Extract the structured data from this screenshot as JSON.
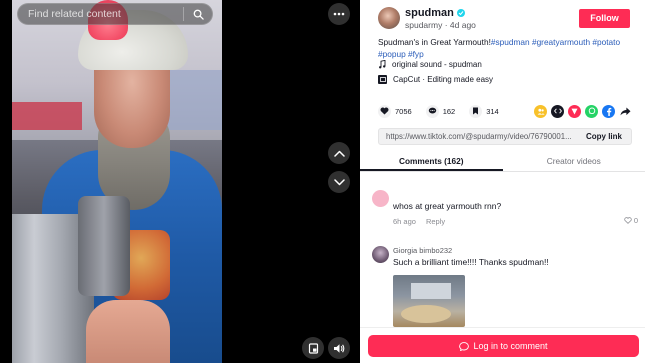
{
  "video": {
    "search": {
      "placeholder": "Find related content"
    }
  },
  "author": {
    "name": "spudman",
    "handle": "spudarmy",
    "posted": "4d ago",
    "follow_label": "Follow"
  },
  "caption": {
    "text": "Spudman's in Great Yarmouth!",
    "tags": [
      "#spudman",
      "#greatyarmouth",
      "#potato",
      "#popup",
      "#fyp"
    ]
  },
  "sound": {
    "label": "original sound - spudman"
  },
  "capcut": {
    "label": "CapCut · Editing made easy"
  },
  "stats": {
    "likes": "7056",
    "comments": "162",
    "saves": "314"
  },
  "link": {
    "url": "https://www.tiktok.com/@spudarmy/video/76790001...",
    "copy_label": "Copy link"
  },
  "tabs": {
    "comments": "Comments (162)",
    "creator": "Creator videos"
  },
  "comments": [
    {
      "user": "",
      "text": "whos at great yarmouth rnn?",
      "age": "6h ago",
      "reply": "Reply",
      "likes": "0"
    },
    {
      "user": "Giorgia bimbo232",
      "text": "Such a brilliant time!!!! Thanks spudman!!"
    }
  ],
  "login": {
    "label": "Log in to comment"
  },
  "colors": {
    "accent": "#fe2c55",
    "hashtag": "#2b5db9",
    "verified": "#20d5ec"
  }
}
